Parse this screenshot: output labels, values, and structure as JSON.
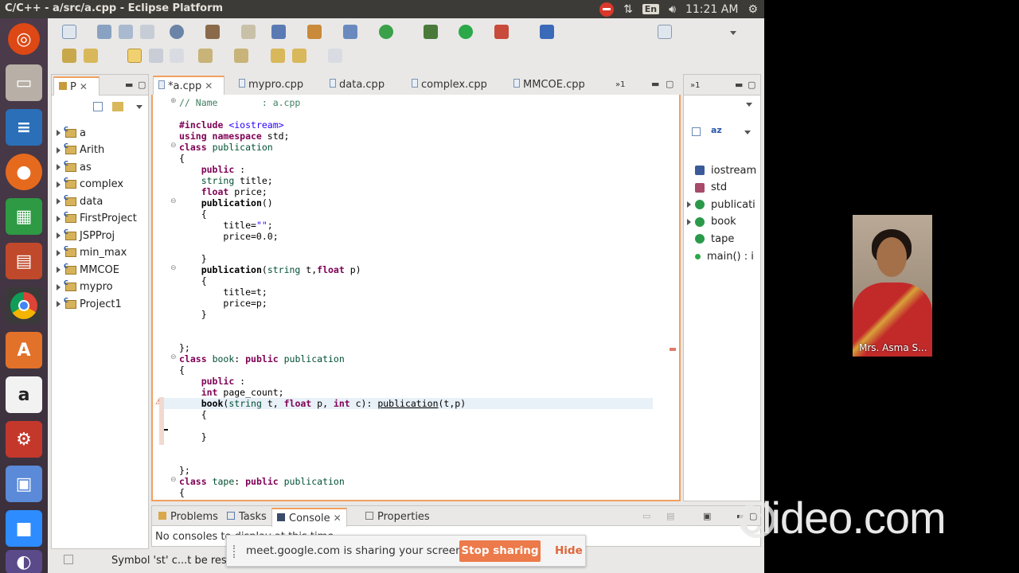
{
  "window": {
    "title": "C/C++ - a/src/a.cpp - Eclipse Platform"
  },
  "tray": {
    "lang": "En",
    "time": "11:21 AM"
  },
  "project_explorer": {
    "tab_label": "P",
    "items": [
      "a",
      "Arith",
      "as",
      "complex",
      "data",
      "FirstProject",
      "JSPProj",
      "min_max",
      "MMCOE",
      "mypro",
      "Project1"
    ]
  },
  "editor": {
    "tabs": [
      "*a.cpp",
      "mypro.cpp",
      "data.cpp",
      "complex.cpp",
      "MMCOE.cpp"
    ],
    "overflow_label": "»1",
    "lines": {
      "l1": "// Name        : a.cpp",
      "l2": "#include <iostream>",
      "l3": "using namespace std;",
      "l4": "class publication",
      "l5": "{",
      "l6": "    public :",
      "l7": "    string title;",
      "l8": "    float price;",
      "l9": "    publication()",
      "l10": "    {",
      "l11": "        title=\"\";",
      "l12": "        price=0.0;",
      "l13": "    }",
      "l14": "    publication(string t,float p)",
      "l15": "    {",
      "l16": "        title=t;",
      "l17": "        price=p;",
      "l18": "    }",
      "l19": "};",
      "l20": "class book: public publication",
      "l21": "{",
      "l22": "    public :",
      "l23": "    int page_count;",
      "l24": "    book(string t, float p, int c): publication(t,p)",
      "l25": "    {",
      "l26": "    }",
      "l27": "};",
      "l28": "class tape: public publication",
      "l29": "{"
    }
  },
  "outline": {
    "overflow_label": "»1",
    "items": [
      "iostream",
      "std",
      "publicati",
      "book",
      "tape",
      "main() : i"
    ]
  },
  "bottom_panel": {
    "tabs": [
      "Problems",
      "Tasks",
      "Console",
      "Properties"
    ],
    "console_text": "No consoles to display at this time."
  },
  "status": {
    "text": "Symbol 'st' c...t be reso"
  },
  "sharebar": {
    "message": "meet.google.com is sharing your screen.",
    "stop_label": "Stop sharing",
    "hide_label": "Hide"
  },
  "video": {
    "name": "Mrs. Asma S..."
  },
  "watermark": {
    "text": "clideo.com"
  }
}
